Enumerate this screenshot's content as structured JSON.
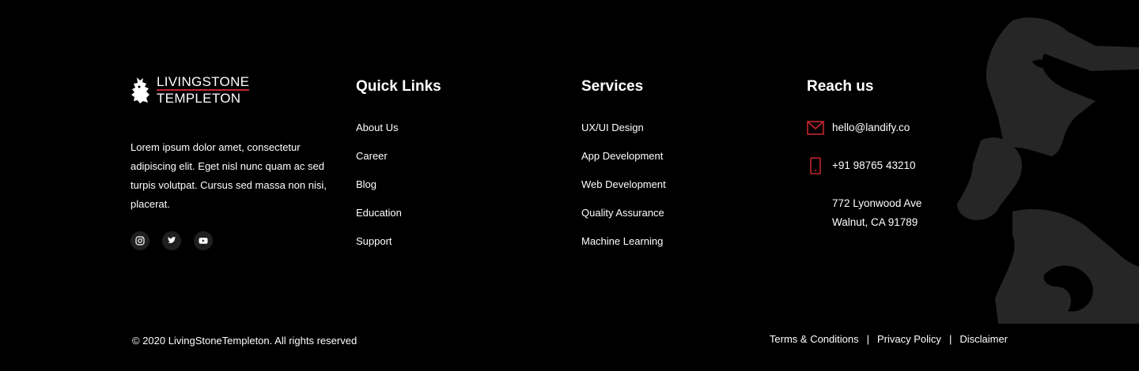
{
  "brand": {
    "logo_line1": "LIVINGSTONE",
    "logo_line2": "TEMPLETON",
    "description": "Lorem ipsum dolor amet, consectetur adipiscing elit. Eget nisl nunc quam ac sed turpis volutpat. Cursus sed massa non nisi, placerat.",
    "socials": [
      {
        "icon": "instagram-icon"
      },
      {
        "icon": "twitter-icon"
      },
      {
        "icon": "youtube-icon"
      }
    ]
  },
  "quick_links": {
    "heading": "Quick Links",
    "items": [
      "About Us",
      "Career",
      "Blog",
      "Education",
      "Support"
    ]
  },
  "services": {
    "heading": "Services",
    "items": [
      "UX/UI Design",
      "App Development",
      "Web Development",
      "Quality Assurance",
      "Machine Learning"
    ]
  },
  "contact": {
    "heading": "Reach us",
    "email": "hello@landify.co",
    "phone": "+91 98765 43210",
    "address_line1": "772 Lyonwood Ave",
    "address_line2": "Walnut, CA 91789"
  },
  "bottom": {
    "copyright": "© 2020 LivingStoneTempleton. All rights reserved",
    "legal_links": [
      "Terms & Conditions",
      "Privacy Policy",
      "Disclaimer"
    ],
    "separator": "|"
  },
  "colors": {
    "background": "#000000",
    "accent": "#c4262e",
    "watermark": "#262626"
  }
}
